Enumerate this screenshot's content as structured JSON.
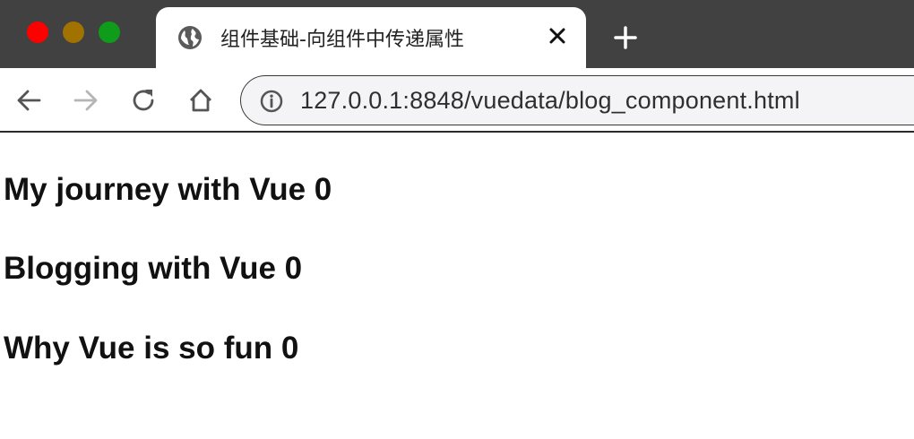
{
  "window": {
    "controls": [
      "close-button",
      "minimize-button",
      "maximize-button"
    ]
  },
  "tab": {
    "title": "组件基础-向组件中传递属性",
    "icon": "globe-icon",
    "close_icon": "close-icon"
  },
  "toolbar": {
    "back_icon": "arrow-left-icon",
    "forward_icon": "arrow-right-icon",
    "reload_icon": "reload-icon",
    "home_icon": "home-icon",
    "info_icon": "info-icon",
    "url": "127.0.0.1:8848/vuedata/blog_component.html"
  },
  "page": {
    "posts": [
      {
        "title": "My journey with Vue 0"
      },
      {
        "title": "Blogging with Vue 0"
      },
      {
        "title": "Why Vue is so fun 0"
      }
    ]
  },
  "colors": {
    "tabstrip": "#414141",
    "close": "#fd0000",
    "minimize": "#a17200",
    "maximize": "#0e9c1a"
  }
}
